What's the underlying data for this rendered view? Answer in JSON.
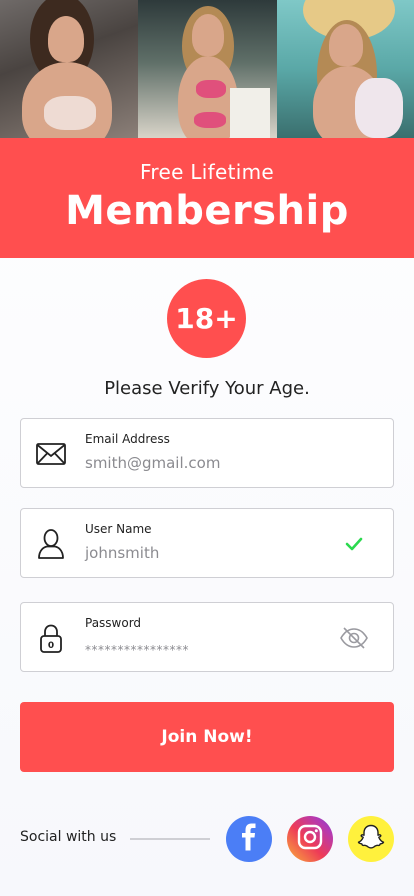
{
  "banner": {
    "subtitle": "Free Lifetime",
    "title": "Membership"
  },
  "badge": {
    "text": "18+"
  },
  "verify_text": "Please Verify Your Age.",
  "form": {
    "email": {
      "label": "Email Address",
      "placeholder": "smith@gmail.com",
      "icon": "envelope-icon"
    },
    "username": {
      "label": "User Name",
      "placeholder": "johnsmith",
      "icon": "user-icon",
      "status_icon": "checkmark-icon"
    },
    "password": {
      "label": "Password",
      "placeholder": "****************",
      "icon": "lock-icon",
      "toggle_icon": "eye-hidden-icon"
    }
  },
  "join_button": {
    "label": "Join Now!"
  },
  "social": {
    "label": "Social with us",
    "networks": [
      "facebook",
      "instagram",
      "snapchat"
    ]
  },
  "colors": {
    "accent": "#ff4f4f",
    "check": "#2bd94f",
    "facebook": "#4b7ef6",
    "snapchat": "#fff13d"
  }
}
